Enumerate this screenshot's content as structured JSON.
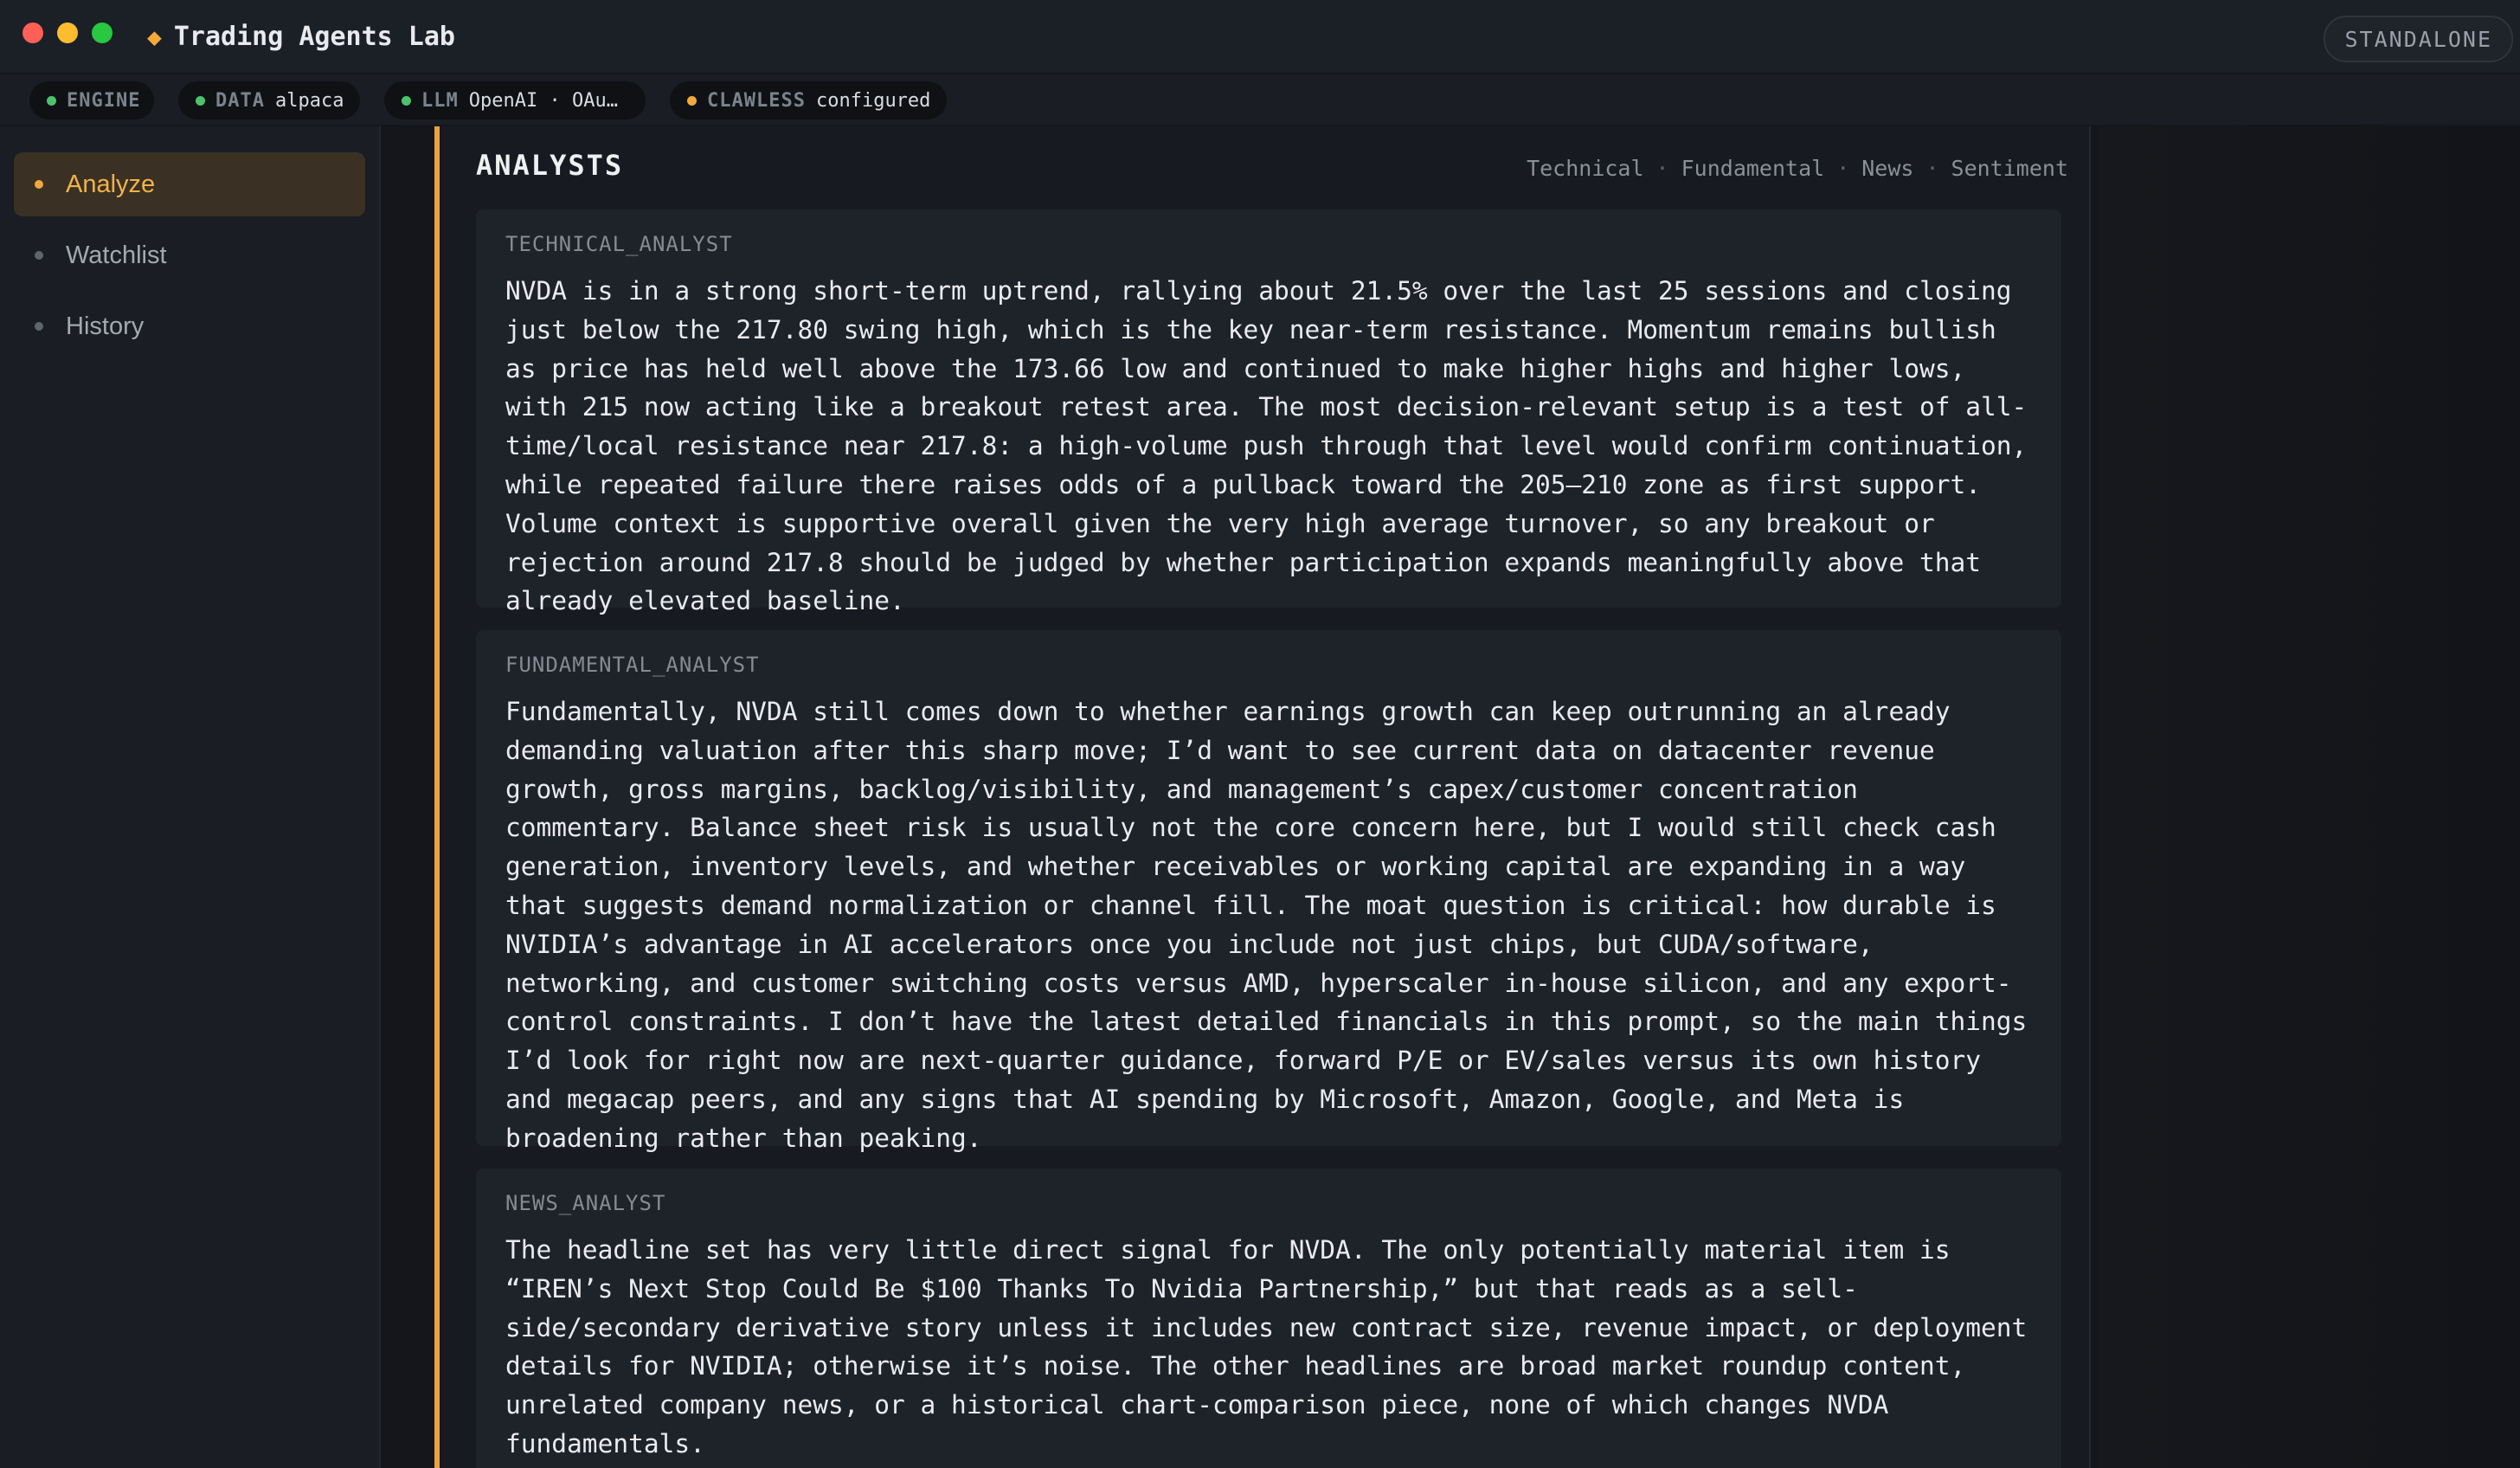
{
  "window": {
    "title": "Trading Agents Lab",
    "mode_badge": "STANDALONE"
  },
  "status": {
    "pills": [
      {
        "key": "ENGINE",
        "value": "",
        "dot_color": "#4cc36b"
      },
      {
        "key": "DATA",
        "value": "alpaca",
        "dot_color": "#4cc36b"
      },
      {
        "key": "LLM",
        "value": "OpenAI · OAu…",
        "dot_color": "#4cc36b"
      },
      {
        "key": "CLAWLESS",
        "value": "configured",
        "dot_color": "#f2a93b"
      }
    ]
  },
  "sidebar": {
    "items": [
      {
        "label": "Analyze",
        "active": true
      },
      {
        "label": "Watchlist",
        "active": false
      },
      {
        "label": "History",
        "active": false
      }
    ]
  },
  "analysts": {
    "title": "ANALYSTS",
    "tags": [
      "Technical",
      "Fundamental",
      "News",
      "Sentiment"
    ],
    "cards": [
      {
        "label": "TECHNICAL_ANALYST",
        "text": "NVDA is in a strong short-term uptrend, rallying about 21.5% over the last 25 sessions and closing just below the 217.80 swing high, which is the key near-term resistance. Momentum remains bullish as price has held well above the 173.66 low and continued to make higher highs and higher lows, with 215 now acting like a breakout retest area. The most decision-relevant setup is a test of all-time/local resistance near 217.8: a high-volume push through that level would confirm continuation, while repeated failure there raises odds of a pullback toward the 205–210 zone as first support. Volume context is supportive overall given the very high average turnover, so any breakout or rejection around 217.8 should be judged by whether participation expands meaningfully above that already elevated baseline."
      },
      {
        "label": "FUNDAMENTAL_ANALYST",
        "text": "Fundamentally, NVDA still comes down to whether earnings growth can keep outrunning an already demanding valuation after this sharp move; I’d want to see current data on datacenter revenue growth, gross margins, backlog/visibility, and management’s capex/customer concentration commentary. Balance sheet risk is usually not the core concern here, but I would still check cash generation, inventory levels, and whether receivables or working capital are expanding in a way that suggests demand normalization or channel fill. The moat question is critical: how durable is NVIDIA’s advantage in AI accelerators once you include not just chips, but CUDA/software, networking, and customer switching costs versus AMD, hyperscaler in-house silicon, and any export-control constraints. I don’t have the latest detailed financials in this prompt, so the main things I’d look for right now are next-quarter guidance, forward P/E or EV/sales versus its own history and megacap peers, and any signs that AI spending by Microsoft, Amazon, Google, and Meta is broadening rather than peaking."
      },
      {
        "label": "NEWS_ANALYST",
        "text": "The headline set has very little direct signal for NVDA. The only potentially material item is “IREN’s Next Stop Could Be $100 Thanks To Nvidia Partnership,” but that reads as a sell-side/secondary derivative story unless it includes new contract size, revenue impact, or deployment details for NVIDIA; otherwise it’s noise. The other headlines are broad market roundup content, unrelated company news, or a historical chart-comparison piece, none of which changes NVDA fundamentals."
      }
    ]
  }
}
